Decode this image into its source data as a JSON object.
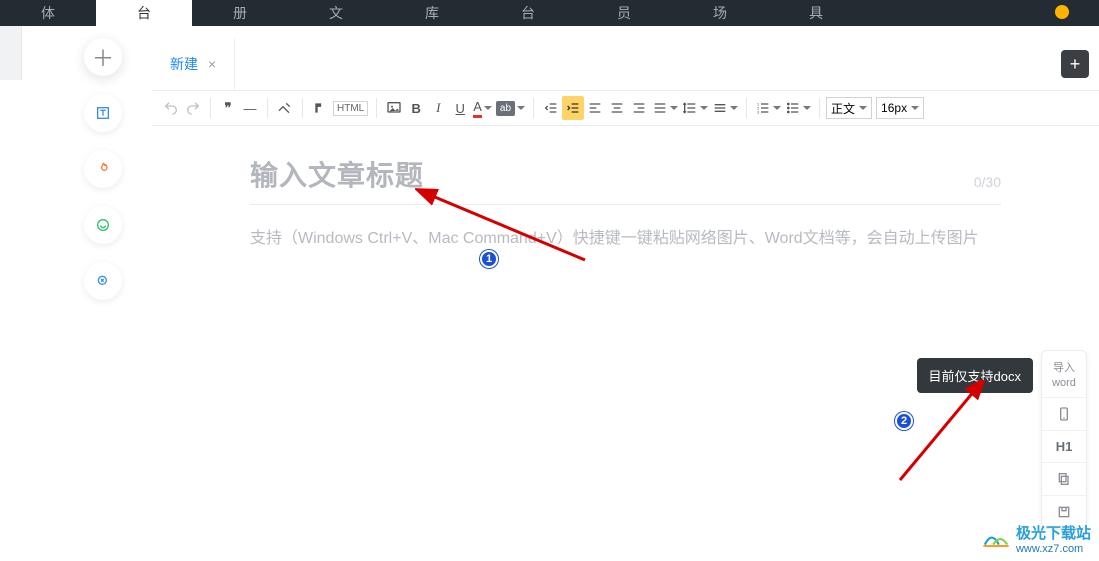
{
  "topnav": {
    "items": [
      "体",
      "台",
      "册",
      "文",
      "库",
      "台",
      "员",
      "场",
      "具"
    ],
    "active_index": 1
  },
  "leftcol": {
    "newbtn_glyph": "＋"
  },
  "tab": {
    "name": "新建",
    "close_glyph": "×"
  },
  "addtab_glyph": "+",
  "toolbar": {
    "quote_glyph": "❞",
    "hr_glyph": "—",
    "eraser_glyph": "⌫",
    "brush_glyph": "✎",
    "html_label": "HTML",
    "image_glyph": "▣",
    "bold_glyph": "B",
    "italic_glyph": "I",
    "underline_glyph": "U",
    "fontcolor_glyph": "A",
    "bgcolor_glyph": "ab",
    "style_select": "正文",
    "size_select": "16px"
  },
  "title": {
    "placeholder": "输入文章标题",
    "counter": "0/30"
  },
  "body": {
    "placeholder": "支持（Windows Ctrl+V、Mac Command+V）快捷键一键粘贴网络图片、Word文档等，会自动上传图片"
  },
  "floatbox": {
    "import_word_line1": "导入",
    "import_word_line2": "word",
    "h1_label": "H1"
  },
  "tooltip": {
    "import_word": "目前仅支持docx"
  },
  "annotations": {
    "step1": "1",
    "step2": "2"
  },
  "watermark": {
    "line1": "极光下载站",
    "line2": "www.xz7.com"
  }
}
